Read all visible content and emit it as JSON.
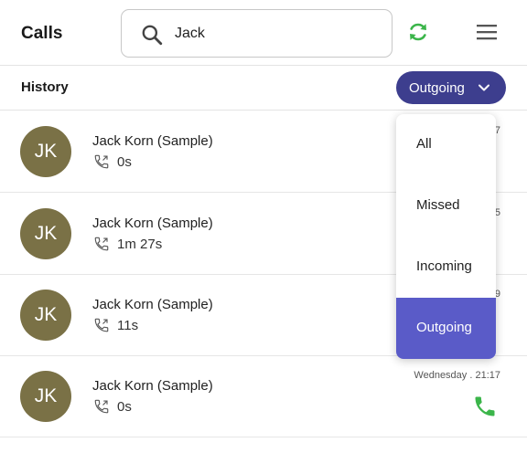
{
  "header": {
    "title": "Calls"
  },
  "search": {
    "value": "Jack",
    "placeholder": "Search"
  },
  "subheader": {
    "title": "History"
  },
  "filter": {
    "selected": "Outgoing",
    "options": [
      "All",
      "Missed",
      "Incoming",
      "Outgoing"
    ]
  },
  "calls": [
    {
      "initials": "JK",
      "name": "Jack Korn (Sample)",
      "duration": "0s",
      "time": "7"
    },
    {
      "initials": "JK",
      "name": "Jack Korn (Sample)",
      "duration": "1m 27s",
      "time": "5"
    },
    {
      "initials": "JK",
      "name": "Jack Korn (Sample)",
      "duration": "11s",
      "time": "9"
    },
    {
      "initials": "JK",
      "name": "Jack Korn (Sample)",
      "duration": "0s",
      "time": "Wednesday . 21:17"
    }
  ],
  "colors": {
    "accent": "#3d3e8e",
    "selected_option": "#5a5bc8",
    "avatar": "#7a7146",
    "green": "#3bb54a"
  },
  "icons": {
    "search": "search-icon",
    "refresh": "refresh-icon",
    "menu": "hamburger-menu-icon",
    "chevron": "chevron-down-icon",
    "outgoing_call": "outgoing-call-icon",
    "call": "phone-icon"
  }
}
